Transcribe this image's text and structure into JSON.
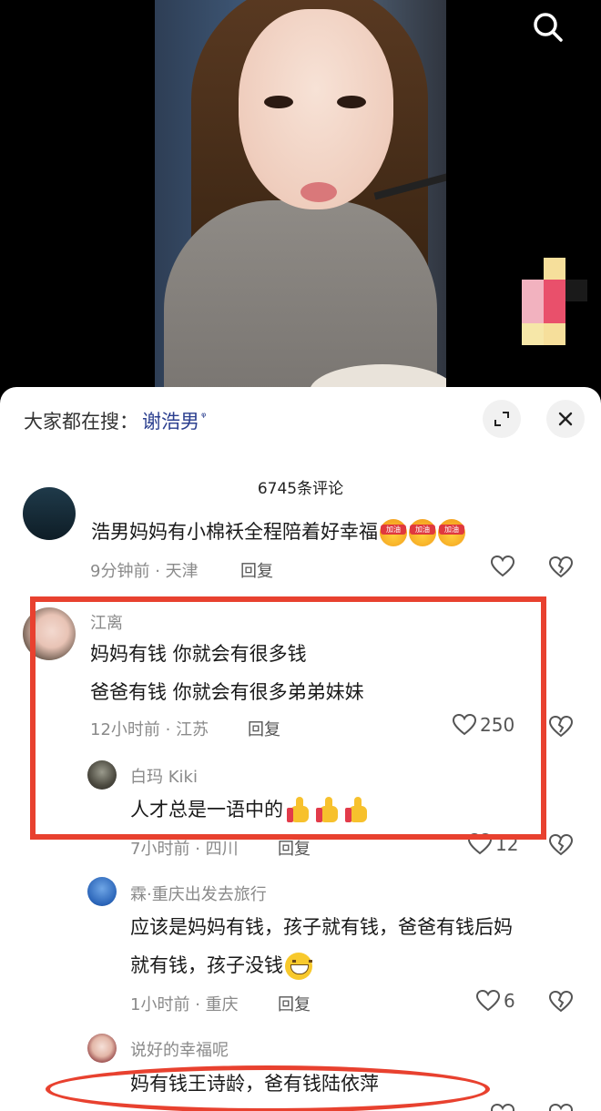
{
  "video": {
    "search_icon": "search-icon"
  },
  "panel": {
    "search_prefix": "大家都在搜：",
    "search_keyword": "谢浩男",
    "search_keyword_icon": "ᵠ",
    "expand_icon": "expand-icon",
    "close_icon": "close-icon",
    "comment_count": "6745条评论"
  },
  "comments": [
    {
      "name": "",
      "text_lines": [
        "浩男妈妈有小棉袄全程陪着好幸福"
      ],
      "emoji": [
        "加油",
        "加油",
        "加油"
      ],
      "time": "9分钟前",
      "location": "天津",
      "reply": "回复",
      "likes": ""
    },
    {
      "name": "江离",
      "text_lines": [
        "妈妈有钱 你就会有很多钱",
        "爸爸有钱 你就会有很多弟弟妹妹"
      ],
      "time": "12小时前",
      "location": "江苏",
      "reply": "回复",
      "likes": "250",
      "replies": [
        {
          "name": "白玛 Kiki",
          "text": "人才总是一语中的",
          "time": "7小时前",
          "location": "四川",
          "reply": "回复",
          "likes": "12"
        },
        {
          "name": "霖·重庆出发去旅行",
          "text_lines": [
            "应该是妈妈有钱，孩子就有钱，爸爸有钱后妈",
            "就有钱，孩子没钱"
          ],
          "time": "1小时前",
          "location": "重庆",
          "reply": "回复",
          "likes": "6"
        },
        {
          "name": "说好的幸福呢",
          "text": "妈有钱王诗龄，爸有钱陆依萍"
        }
      ]
    }
  ],
  "meta_separator": "·",
  "colors": {
    "annotation": "#e8412f",
    "keyword": "#2b3f8f"
  }
}
